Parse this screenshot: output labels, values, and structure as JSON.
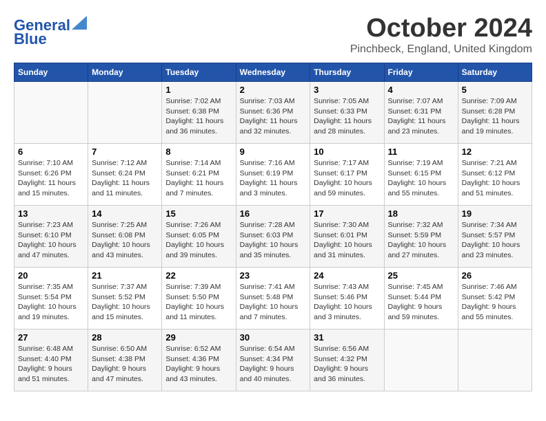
{
  "header": {
    "logo_line1": "General",
    "logo_line2": "Blue",
    "month": "October 2024",
    "location": "Pinchbeck, England, United Kingdom"
  },
  "days_of_week": [
    "Sunday",
    "Monday",
    "Tuesday",
    "Wednesday",
    "Thursday",
    "Friday",
    "Saturday"
  ],
  "weeks": [
    [
      {
        "day": "",
        "info": ""
      },
      {
        "day": "",
        "info": ""
      },
      {
        "day": "1",
        "info": "Sunrise: 7:02 AM\nSunset: 6:38 PM\nDaylight: 11 hours and 36 minutes."
      },
      {
        "day": "2",
        "info": "Sunrise: 7:03 AM\nSunset: 6:36 PM\nDaylight: 11 hours and 32 minutes."
      },
      {
        "day": "3",
        "info": "Sunrise: 7:05 AM\nSunset: 6:33 PM\nDaylight: 11 hours and 28 minutes."
      },
      {
        "day": "4",
        "info": "Sunrise: 7:07 AM\nSunset: 6:31 PM\nDaylight: 11 hours and 23 minutes."
      },
      {
        "day": "5",
        "info": "Sunrise: 7:09 AM\nSunset: 6:28 PM\nDaylight: 11 hours and 19 minutes."
      }
    ],
    [
      {
        "day": "6",
        "info": "Sunrise: 7:10 AM\nSunset: 6:26 PM\nDaylight: 11 hours and 15 minutes."
      },
      {
        "day": "7",
        "info": "Sunrise: 7:12 AM\nSunset: 6:24 PM\nDaylight: 11 hours and 11 minutes."
      },
      {
        "day": "8",
        "info": "Sunrise: 7:14 AM\nSunset: 6:21 PM\nDaylight: 11 hours and 7 minutes."
      },
      {
        "day": "9",
        "info": "Sunrise: 7:16 AM\nSunset: 6:19 PM\nDaylight: 11 hours and 3 minutes."
      },
      {
        "day": "10",
        "info": "Sunrise: 7:17 AM\nSunset: 6:17 PM\nDaylight: 10 hours and 59 minutes."
      },
      {
        "day": "11",
        "info": "Sunrise: 7:19 AM\nSunset: 6:15 PM\nDaylight: 10 hours and 55 minutes."
      },
      {
        "day": "12",
        "info": "Sunrise: 7:21 AM\nSunset: 6:12 PM\nDaylight: 10 hours and 51 minutes."
      }
    ],
    [
      {
        "day": "13",
        "info": "Sunrise: 7:23 AM\nSunset: 6:10 PM\nDaylight: 10 hours and 47 minutes."
      },
      {
        "day": "14",
        "info": "Sunrise: 7:25 AM\nSunset: 6:08 PM\nDaylight: 10 hours and 43 minutes."
      },
      {
        "day": "15",
        "info": "Sunrise: 7:26 AM\nSunset: 6:05 PM\nDaylight: 10 hours and 39 minutes."
      },
      {
        "day": "16",
        "info": "Sunrise: 7:28 AM\nSunset: 6:03 PM\nDaylight: 10 hours and 35 minutes."
      },
      {
        "day": "17",
        "info": "Sunrise: 7:30 AM\nSunset: 6:01 PM\nDaylight: 10 hours and 31 minutes."
      },
      {
        "day": "18",
        "info": "Sunrise: 7:32 AM\nSunset: 5:59 PM\nDaylight: 10 hours and 27 minutes."
      },
      {
        "day": "19",
        "info": "Sunrise: 7:34 AM\nSunset: 5:57 PM\nDaylight: 10 hours and 23 minutes."
      }
    ],
    [
      {
        "day": "20",
        "info": "Sunrise: 7:35 AM\nSunset: 5:54 PM\nDaylight: 10 hours and 19 minutes."
      },
      {
        "day": "21",
        "info": "Sunrise: 7:37 AM\nSunset: 5:52 PM\nDaylight: 10 hours and 15 minutes."
      },
      {
        "day": "22",
        "info": "Sunrise: 7:39 AM\nSunset: 5:50 PM\nDaylight: 10 hours and 11 minutes."
      },
      {
        "day": "23",
        "info": "Sunrise: 7:41 AM\nSunset: 5:48 PM\nDaylight: 10 hours and 7 minutes."
      },
      {
        "day": "24",
        "info": "Sunrise: 7:43 AM\nSunset: 5:46 PM\nDaylight: 10 hours and 3 minutes."
      },
      {
        "day": "25",
        "info": "Sunrise: 7:45 AM\nSunset: 5:44 PM\nDaylight: 9 hours and 59 minutes."
      },
      {
        "day": "26",
        "info": "Sunrise: 7:46 AM\nSunset: 5:42 PM\nDaylight: 9 hours and 55 minutes."
      }
    ],
    [
      {
        "day": "27",
        "info": "Sunrise: 6:48 AM\nSunset: 4:40 PM\nDaylight: 9 hours and 51 minutes."
      },
      {
        "day": "28",
        "info": "Sunrise: 6:50 AM\nSunset: 4:38 PM\nDaylight: 9 hours and 47 minutes."
      },
      {
        "day": "29",
        "info": "Sunrise: 6:52 AM\nSunset: 4:36 PM\nDaylight: 9 hours and 43 minutes."
      },
      {
        "day": "30",
        "info": "Sunrise: 6:54 AM\nSunset: 4:34 PM\nDaylight: 9 hours and 40 minutes."
      },
      {
        "day": "31",
        "info": "Sunrise: 6:56 AM\nSunset: 4:32 PM\nDaylight: 9 hours and 36 minutes."
      },
      {
        "day": "",
        "info": ""
      },
      {
        "day": "",
        "info": ""
      }
    ]
  ]
}
